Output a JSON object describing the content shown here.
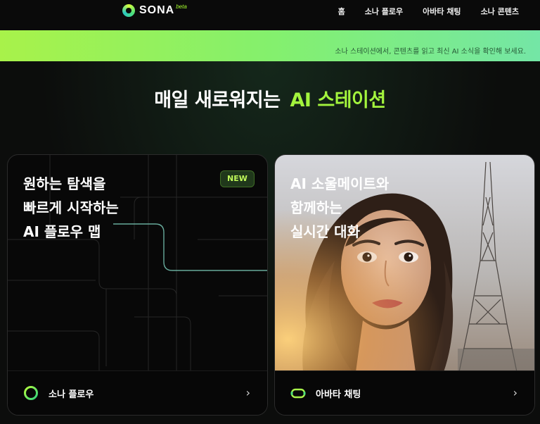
{
  "header": {
    "logo_text": "SONA",
    "logo_beta": "beta",
    "nav": [
      {
        "label": "홈"
      },
      {
        "label": "소나 플로우"
      },
      {
        "label": "아바타 채팅"
      },
      {
        "label": "소나 콘텐츠"
      }
    ]
  },
  "banner": {
    "text": "소나 스테이션에서, 콘텐츠를 읽고 최신 AI 소식을 확인해 보세요."
  },
  "hero": {
    "title_prefix": "매일 새로워지는",
    "title_highlight": "AI 스테이션"
  },
  "cards": [
    {
      "title": "원하는 탐색을\n빠르게 시작하는\nAI 플로우 맵",
      "badge": "NEW",
      "footer_label": "소나 플로우",
      "icon": "flow-ring-icon"
    },
    {
      "title": "AI 소울메이트와\n함께하는\n실시간 대화",
      "footer_label": "아바타 채팅",
      "icon": "avatar-chat-icon"
    }
  ],
  "colors": {
    "accent": "#a3f43d",
    "banner_start": "#a8f24a",
    "banner_end": "#74e6a6",
    "background": "#0c0d0c"
  }
}
